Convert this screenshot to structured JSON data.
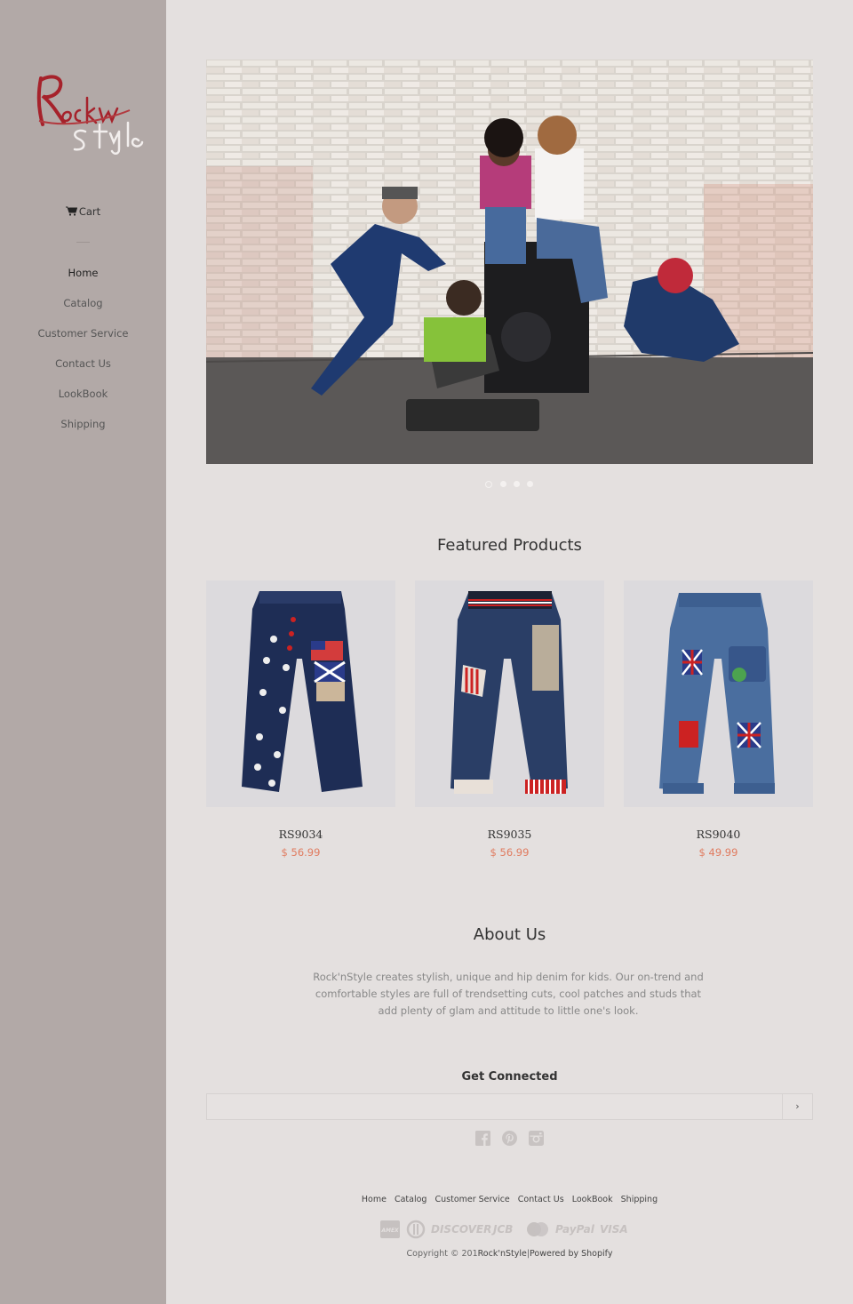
{
  "brand": {
    "logo_line1": "Rock'n",
    "logo_line2": "Style",
    "accent": "#b12a2f"
  },
  "sidebar": {
    "cart_label": "Cart",
    "nav": [
      {
        "label": "Home",
        "active": true
      },
      {
        "label": "Catalog"
      },
      {
        "label": "Customer Service"
      },
      {
        "label": "Contact Us"
      },
      {
        "label": "LookBook"
      },
      {
        "label": "Shipping"
      }
    ]
  },
  "slideshow": {
    "slide_count": 4,
    "active_index": 0
  },
  "featured": {
    "title": "Featured Products",
    "products": [
      {
        "name": "RS9034",
        "price": "$ 56.99"
      },
      {
        "name": "RS9035",
        "price": "$ 56.99"
      },
      {
        "name": "RS9040",
        "price": "$ 49.99"
      }
    ]
  },
  "about": {
    "title": "About Us",
    "text": "Rock'nStyle creates stylish, unique and hip denim for kids.  Our on-trend and comfortable styles are full of trendsetting cuts, cool patches and studs that add plenty of glam and attitude to little one's look."
  },
  "connect": {
    "title": "Get Connected",
    "submit_label": "›",
    "social": [
      "facebook-icon",
      "pinterest-icon",
      "instagram-icon"
    ]
  },
  "footer": {
    "nav": [
      "Home",
      "Catalog",
      "Customer Service",
      "Contact Us",
      "LookBook",
      "Shipping"
    ],
    "payments": [
      "AMEX",
      "DC",
      "DISCOVER",
      "JCB",
      "MC",
      "PayPal",
      "VISA"
    ],
    "copyright_prefix": "Copyright © 201",
    "copyright_brand": "Rock'nStyle",
    "copyright_sep": "|",
    "powered": "Powered by Shopify"
  },
  "colors": {
    "sidebar": "#b2a9a7",
    "background": "#e4e0df",
    "price": "#e07b5f"
  }
}
